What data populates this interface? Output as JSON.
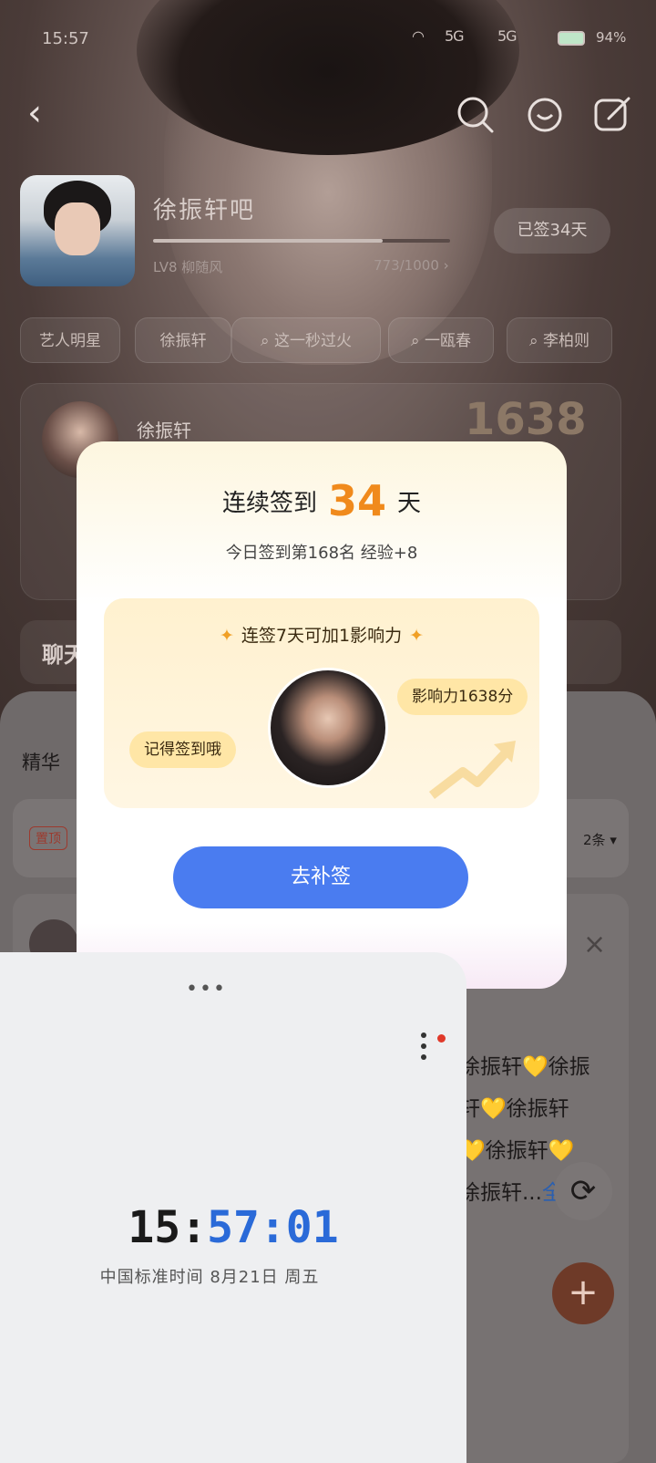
{
  "status_bar": {
    "time": "15:57",
    "signal1": "5G",
    "signal2": "5G",
    "battery": "94%"
  },
  "forum": {
    "name": "徐振轩吧",
    "level": "LV8 柳随风",
    "experience": "773/1000",
    "signed": "已签34天",
    "tags": [
      "艺人明星",
      "徐振轩",
      "这一秒过火",
      "一瓯春",
      "李柏则"
    ]
  },
  "rank_card": {
    "name": "徐振轩",
    "score": "1638"
  },
  "chat_title": "聊天",
  "feed": {
    "title": "精华",
    "pin": "置顶",
    "pin_count": "2条",
    "lines": [
      "徐振轩💛徐振",
      "轩💛徐振轩",
      "💛徐振轩💛",
      "徐振轩..."
    ],
    "more": "全"
  },
  "dialog": {
    "title_prefix": "连续签到",
    "days": "34",
    "title_suffix": "天",
    "subtitle": "今日签到第168名 经验+8",
    "panel_head": "连签7天可加1影响力",
    "bubble_left": "记得签到哦",
    "bubble_right": "影响力1638分",
    "button": "去补签",
    "close": "×"
  },
  "clock_card": {
    "dots": "•••",
    "time_hm": "15:",
    "time_sec": "57:01",
    "date": "中国标准时间 8月21日 周五"
  }
}
